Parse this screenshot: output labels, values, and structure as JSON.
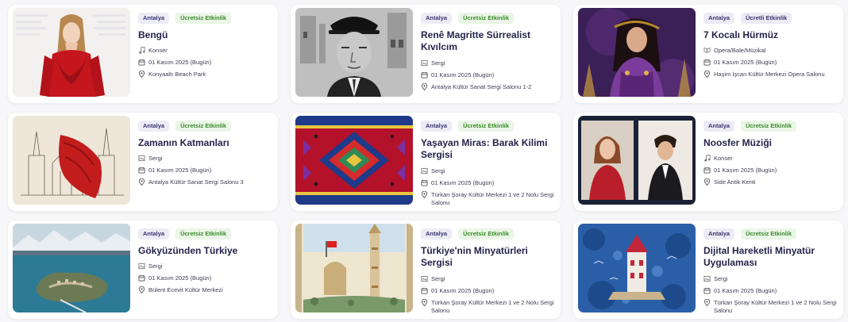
{
  "events": [
    {
      "title": "Bengü",
      "city": "Antalya",
      "price": "Ücretsiz Etkinlik",
      "category": "Konser",
      "category_icon": "music-icon",
      "date": "01 Kasım 2025 (Bugün)",
      "venue": "Konyaaltı Beach Park",
      "image": "portrait-red-dress"
    },
    {
      "title": "Renê Magritte Sürrealist Kıvılcım",
      "city": "Antalya",
      "price": "Ücretsiz Etkinlik",
      "category": "Sergi",
      "category_icon": "exhibition-icon",
      "date": "01 Kasım 2025 (Bugün)",
      "venue": "Antalya Kültür Sanat Sergi Salonu 1-2",
      "image": "bw-portrait-bowler-hat"
    },
    {
      "title": "7 Kocalı Hürmüz",
      "city": "Antalya",
      "price": "Ücretli Etkinlik",
      "category": "Opera/Bale/Müzikal",
      "category_icon": "theatre-icon",
      "date": "01 Kasım 2025 (Bugün)",
      "venue": "Haşim İşcan Kültür Merkezi Opera Salonu",
      "image": "purple-costume-poster"
    },
    {
      "title": "Zamanın Katmanları",
      "city": "Antalya",
      "price": "Ücretsiz Etkinlik",
      "category": "Sergi",
      "category_icon": "exhibition-icon",
      "date": "01 Kasım 2025 (Bugün)",
      "venue": "Antalya Kültür Sanat Sergi Salonu 3",
      "image": "mosque-sketch-red-fabric"
    },
    {
      "title": "Yaşayan Miras: Barak Kilimi Sergisi",
      "city": "Antalya",
      "price": "Ücretsiz Etkinlik",
      "category": "Sergi",
      "category_icon": "exhibition-icon",
      "date": "01 Kasım 2025 (Bugün)",
      "venue": "Türkan Şoray Kültür Merkezi 1 ve 2 Nolu Sergi Salonu",
      "image": "kilim-pattern"
    },
    {
      "title": "Noosfer Müziği",
      "city": "Antalya",
      "price": "Ücretsiz Etkinlik",
      "category": "Konser",
      "category_icon": "music-icon",
      "date": "01 Kasım 2025 (Bugün)",
      "venue": "Side Antik Kenti",
      "image": "duo-portrait"
    },
    {
      "title": "Gökyüzünden Türkiye",
      "city": "Antalya",
      "price": "Ücretsiz Etkinlik",
      "category": "Sergi",
      "category_icon": "exhibition-icon",
      "date": "01 Kasım 2025 (Bugün)",
      "venue": "Bülent Ecevit Kültür Merkezi",
      "image": "aerial-island"
    },
    {
      "title": "Türkiye'nin Minyatürleri Sergisi",
      "city": "Antalya",
      "price": "Ücretsiz Etkinlik",
      "category": "Sergi",
      "category_icon": "exhibition-icon",
      "date": "01 Kasım 2025 (Bugün)",
      "venue": "Türkan Şoray Kültür Merkezi 1 ve 2 Nolu Sergi Salonu",
      "image": "watercolor-minaret"
    },
    {
      "title": "Dijital Hareketli Minyatür Uygulaması",
      "city": "Antalya",
      "price": "Ücretsiz Etkinlik",
      "category": "Sergi",
      "category_icon": "exhibition-icon",
      "date": "01 Kasım 2025 (Bugün)",
      "venue": "Türkan Şoray Kültür Merkezi 1 ve 2 Nolu Sergi Salonu",
      "image": "blue-miniature-tower"
    }
  ],
  "colors": {
    "city_badge_bg": "#ecebf6",
    "free_badge_bg": "#eaf6e6",
    "free_badge_text": "#3c8a2e",
    "title_text": "#25234a"
  }
}
